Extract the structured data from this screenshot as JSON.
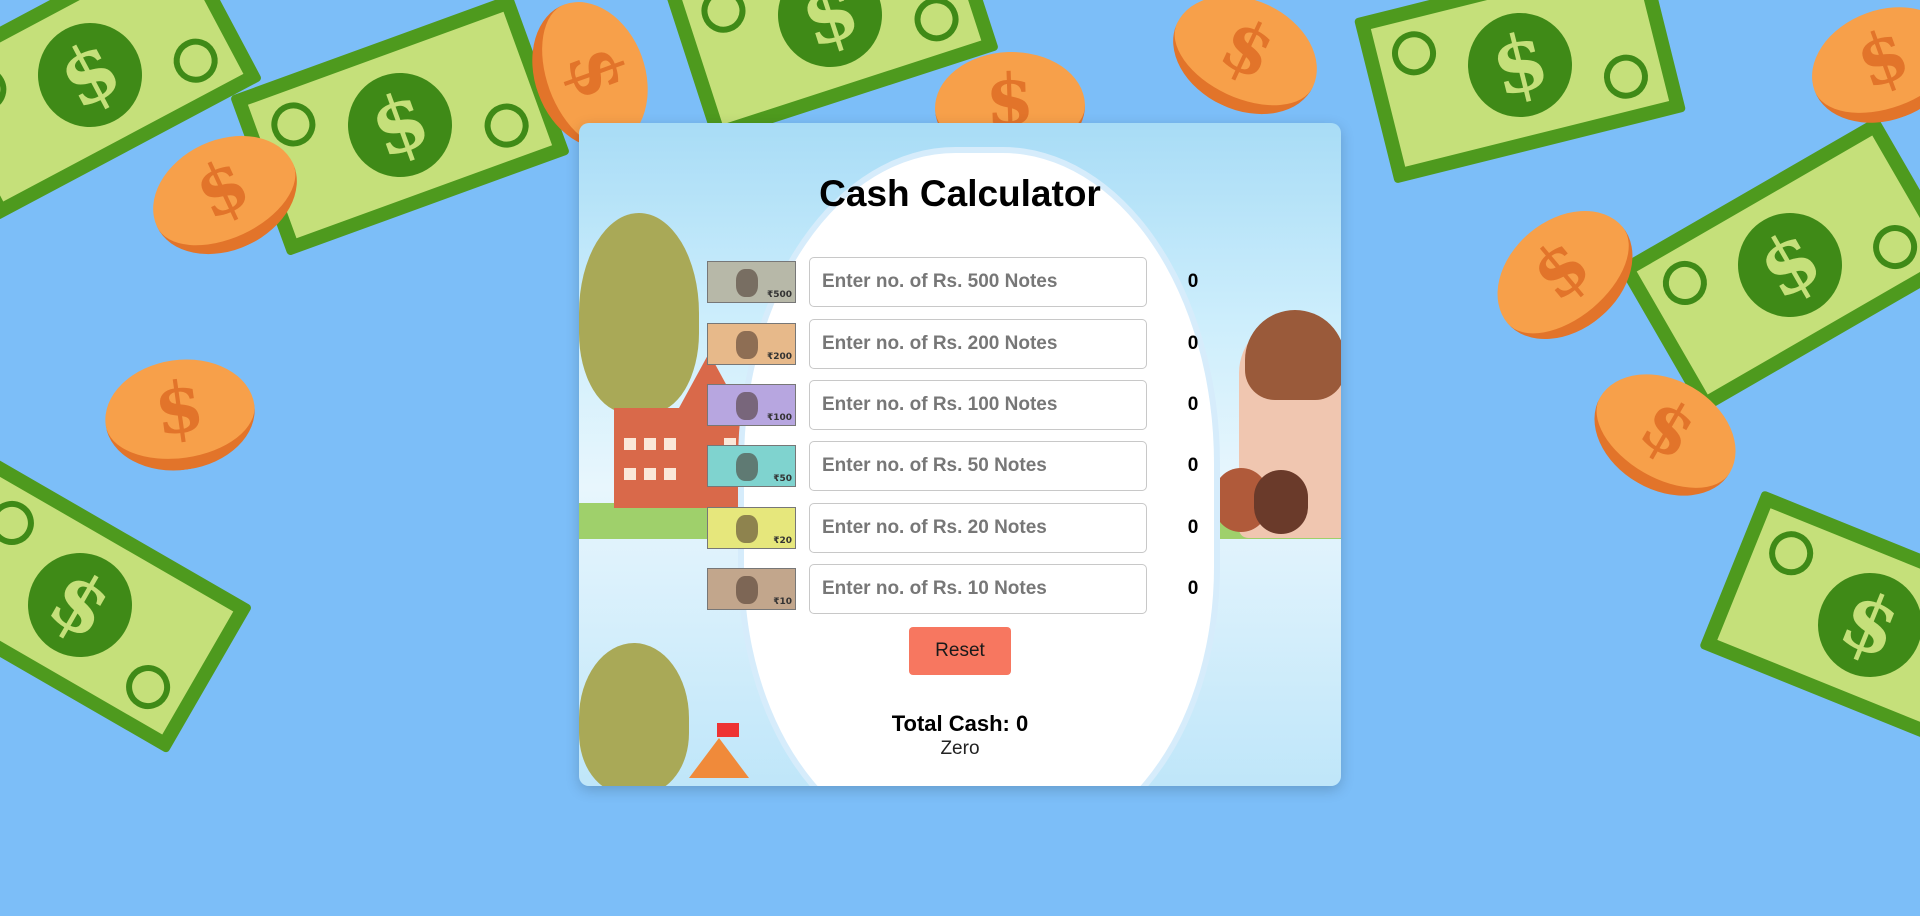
{
  "app": {
    "title": "Cash Calculator"
  },
  "notes": [
    {
      "placeholder": "Enter no. of Rs. 500 Notes",
      "value": "",
      "count": "0",
      "note_label": "₹500",
      "color": "#b7b8a8"
    },
    {
      "placeholder": "Enter no. of Rs. 200 Notes",
      "value": "",
      "count": "0",
      "note_label": "₹200",
      "color": "#e7b98a"
    },
    {
      "placeholder": "Enter no. of Rs. 100 Notes",
      "value": "",
      "count": "0",
      "note_label": "₹100",
      "color": "#b7a6e0"
    },
    {
      "placeholder": "Enter no. of Rs. 50 Notes",
      "value": "",
      "count": "0",
      "note_label": "₹50",
      "color": "#7fd3cf"
    },
    {
      "placeholder": "Enter no. of Rs. 20 Notes",
      "value": "",
      "count": "0",
      "note_label": "₹20",
      "color": "#e6e77c"
    },
    {
      "placeholder": "Enter no. of Rs. 10 Notes",
      "value": "",
      "count": "0",
      "note_label": "₹10",
      "color": "#c2a68c"
    }
  ],
  "actions": {
    "reset_label": "Reset"
  },
  "summary": {
    "total_label": "Total Cash: 0",
    "total_words": "Zero"
  },
  "colors": {
    "page_background": "#7cbef8",
    "reset_button": "#f77760",
    "bill_green": "#4e9a1e",
    "coin_orange": "#f7a04a"
  },
  "decorations": {
    "bill_icon": "dollar-bill-icon",
    "coin_icon": "dollar-coin-icon",
    "bill_symbol": "$",
    "coin_symbol": "$"
  }
}
